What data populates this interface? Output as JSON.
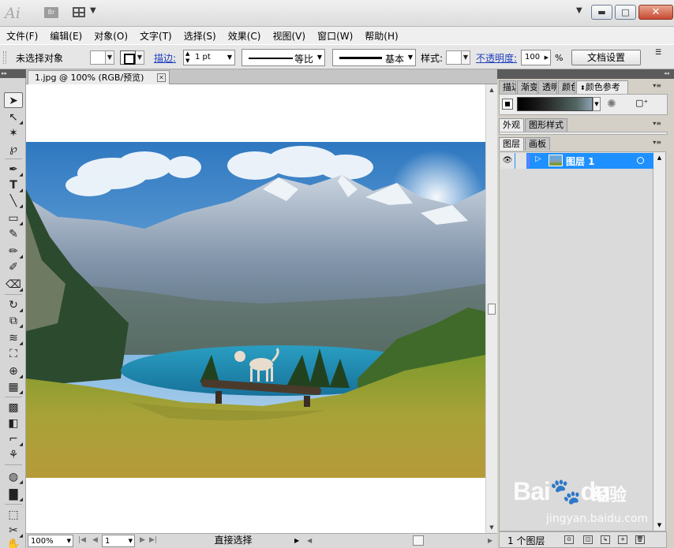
{
  "titlebar": {
    "logo": "Ai",
    "bridge_btn": "Br",
    "window_buttons": {
      "minimize": "▬",
      "maximize": "□",
      "close": "✕"
    }
  },
  "menu": [
    "文件(F)",
    "编辑(E)",
    "对象(O)",
    "文字(T)",
    "选择(S)",
    "效果(C)",
    "视图(V)",
    "窗口(W)",
    "帮助(H)"
  ],
  "control": {
    "selection_status": "未选择对象",
    "stroke_label": "描边:",
    "stroke_weight": "1 pt",
    "variable_width": "等比",
    "brush_def": "基本",
    "style_label": "样式:",
    "opacity_label": "不透明度:",
    "opacity_value": "100",
    "opacity_unit": "%",
    "doc_setup_button": "文档设置"
  },
  "document": {
    "tab_title": "1.jpg @ 100% (RGB/预览)",
    "close_glyph": "✕"
  },
  "status": {
    "zoom": "100%",
    "page": "1",
    "tool_name": "直接选择"
  },
  "panels": {
    "group1_tabs": [
      "描边",
      "渐变",
      "透明",
      "颜色",
      "颜色参考"
    ],
    "group2_tabs": [
      "外观",
      "图形样式"
    ],
    "group3_tabs": [
      "图层",
      "画板"
    ],
    "layer_name": "图层 1",
    "layer_count": "1 个图层"
  },
  "watermark": {
    "brand": "Bai",
    "brand_tail": "du",
    "cn": "经验",
    "url": "jingyan.baidu.com"
  },
  "colors": {
    "selection_blue": "#1e90ff",
    "sky": "#3f86c8",
    "lake": "#1f8fb5",
    "grass": "#a8a238"
  }
}
